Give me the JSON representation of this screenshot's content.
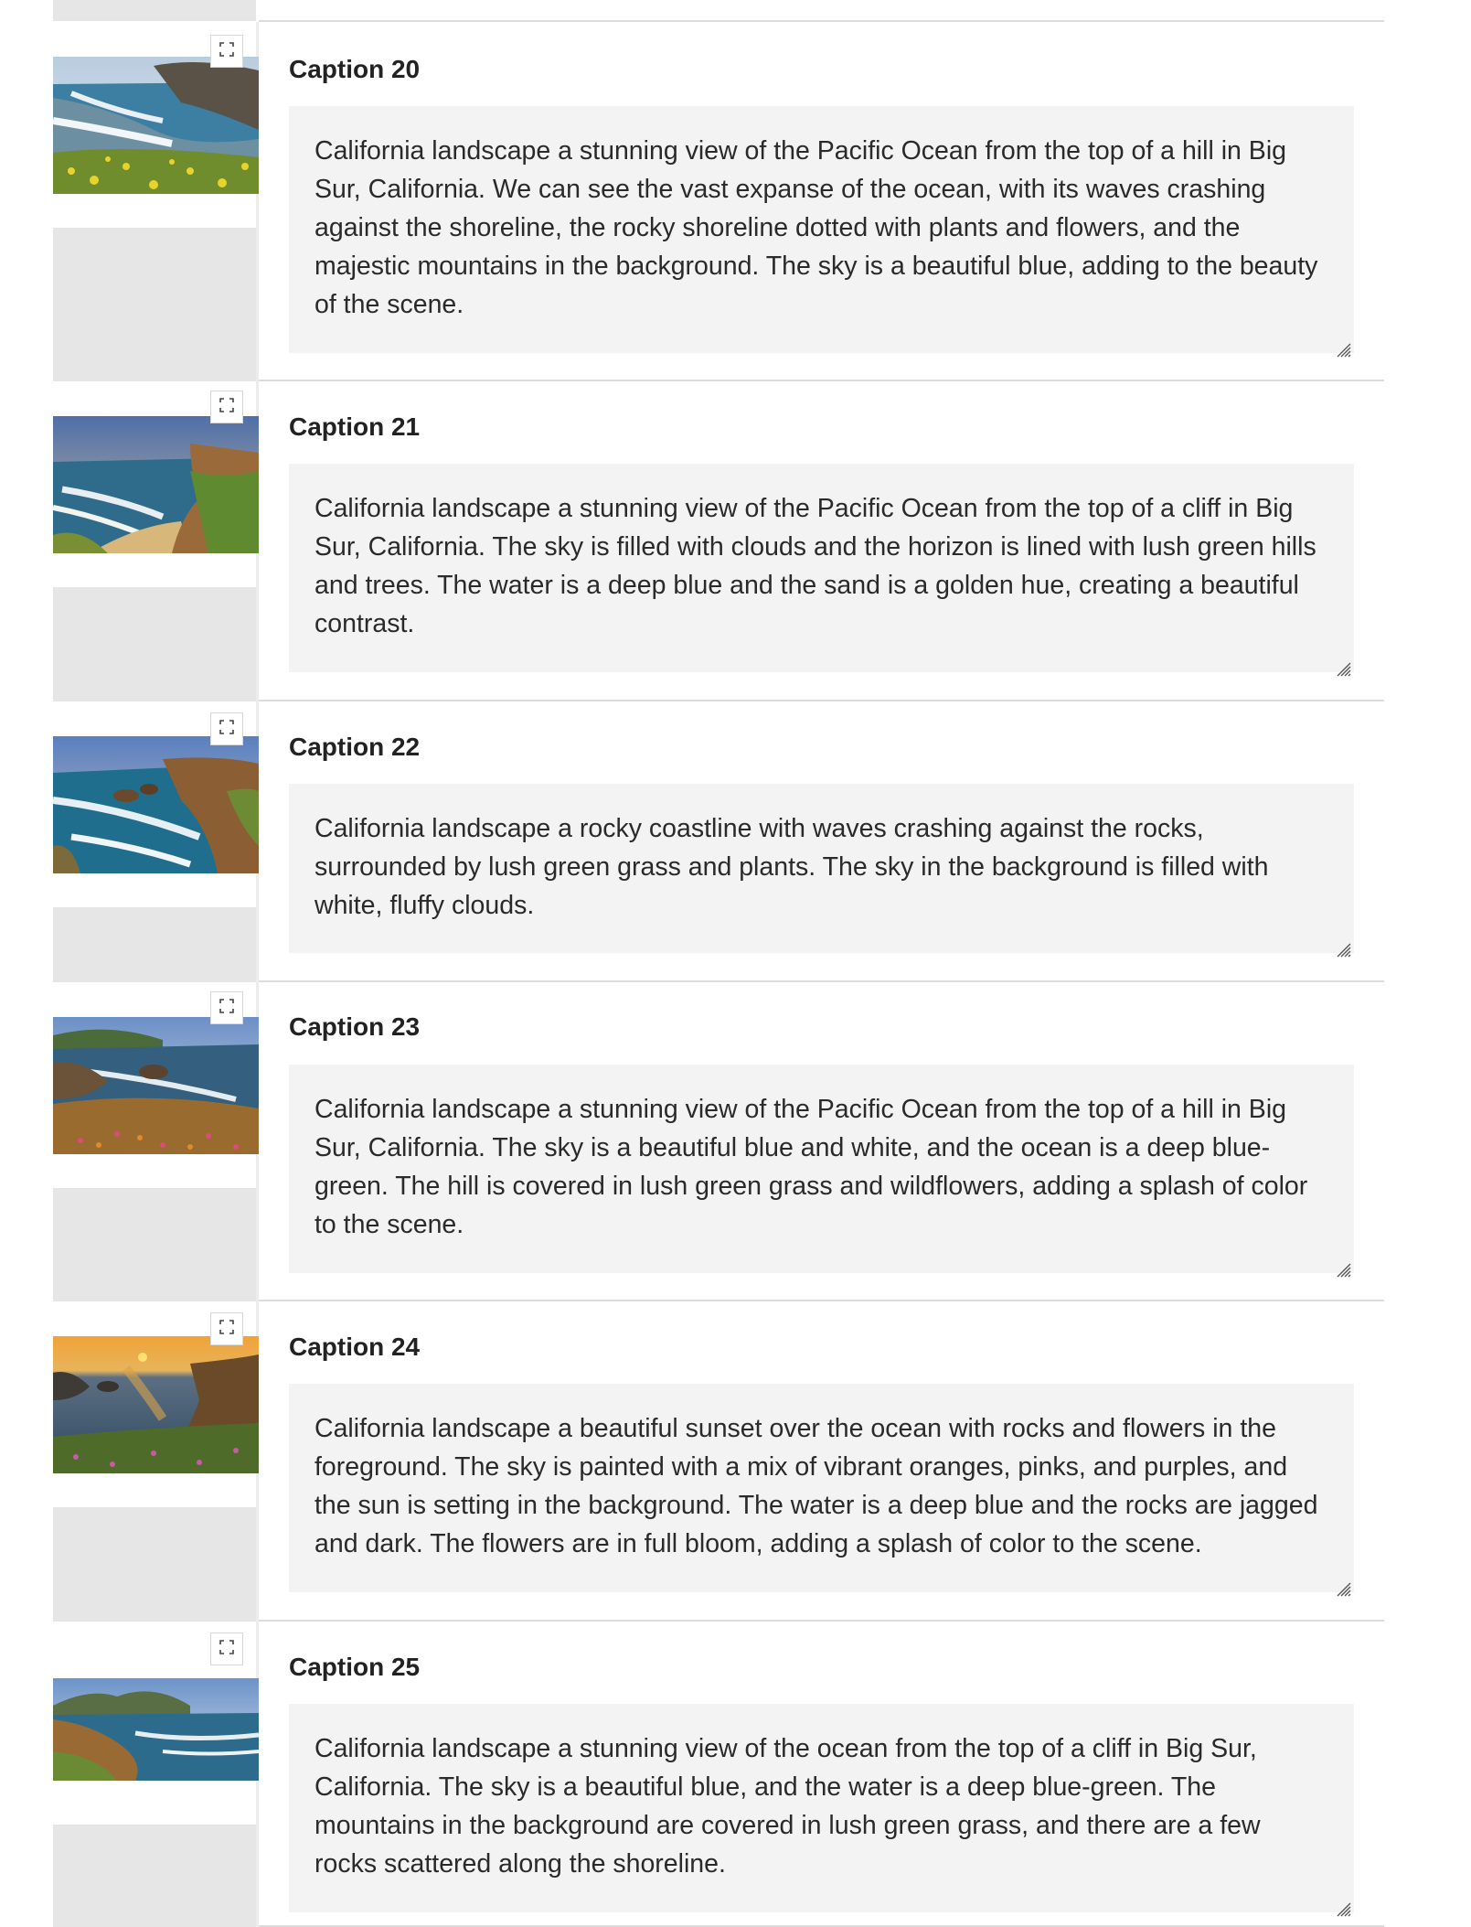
{
  "captions": [
    {
      "title": "Caption 20",
      "text": "California landscape a stunning view of the Pacific Ocean from the top of a hill in Big Sur, California. We can see the vast expanse of the ocean, with its waves crashing against the shoreline, the rocky shoreline dotted with plants and flowers, and the majestic mountains in the background. The sky is a beautiful blue, adding to the beauty of the scene."
    },
    {
      "title": "Caption 21",
      "text": "California landscape a stunning view of the Pacific Ocean from the top of a cliff in Big Sur, California. The sky is filled with clouds and the horizon is lined with lush green hills and trees. The water is a deep blue and the sand is a golden hue, creating a beautiful contrast."
    },
    {
      "title": "Caption 22",
      "text": "California landscape a rocky coastline with waves crashing against the rocks, surrounded by lush green grass and plants. The sky in the background is filled with white, fluffy clouds."
    },
    {
      "title": "Caption 23",
      "text": "California landscape a stunning view of the Pacific Ocean from the top of a hill in Big Sur, California. The sky is a beautiful blue and white, and the ocean is a deep blue-green. The hill is covered in lush green grass and wildflowers, adding a splash of color to the scene."
    },
    {
      "title": "Caption 24",
      "text": "California landscape a beautiful sunset over the ocean with rocks and flowers in the foreground. The sky is painted with a mix of vibrant oranges, pinks, and purples, and the sun is setting in the background. The water is a deep blue and the rocks are jagged and dark. The flowers are in full bloom, adding a splash of color to the scene."
    },
    {
      "title": "Caption 25",
      "text": "California landscape a stunning view of the ocean from the top of a cliff in Big Sur, California. The sky is a beautiful blue, and the water is a deep blue-green. The mountains in the background are covered in lush green grass, and there are a few rocks scattered along the shoreline."
    }
  ],
  "icons": {
    "expand": "fullscreen-expand-icon",
    "resize": "resize-grip-icon"
  },
  "colors": {
    "caption_box_bg": "#f3f3f3",
    "thumb_column_bg": "#e6e6e6",
    "divider": "#dcdcdc"
  }
}
